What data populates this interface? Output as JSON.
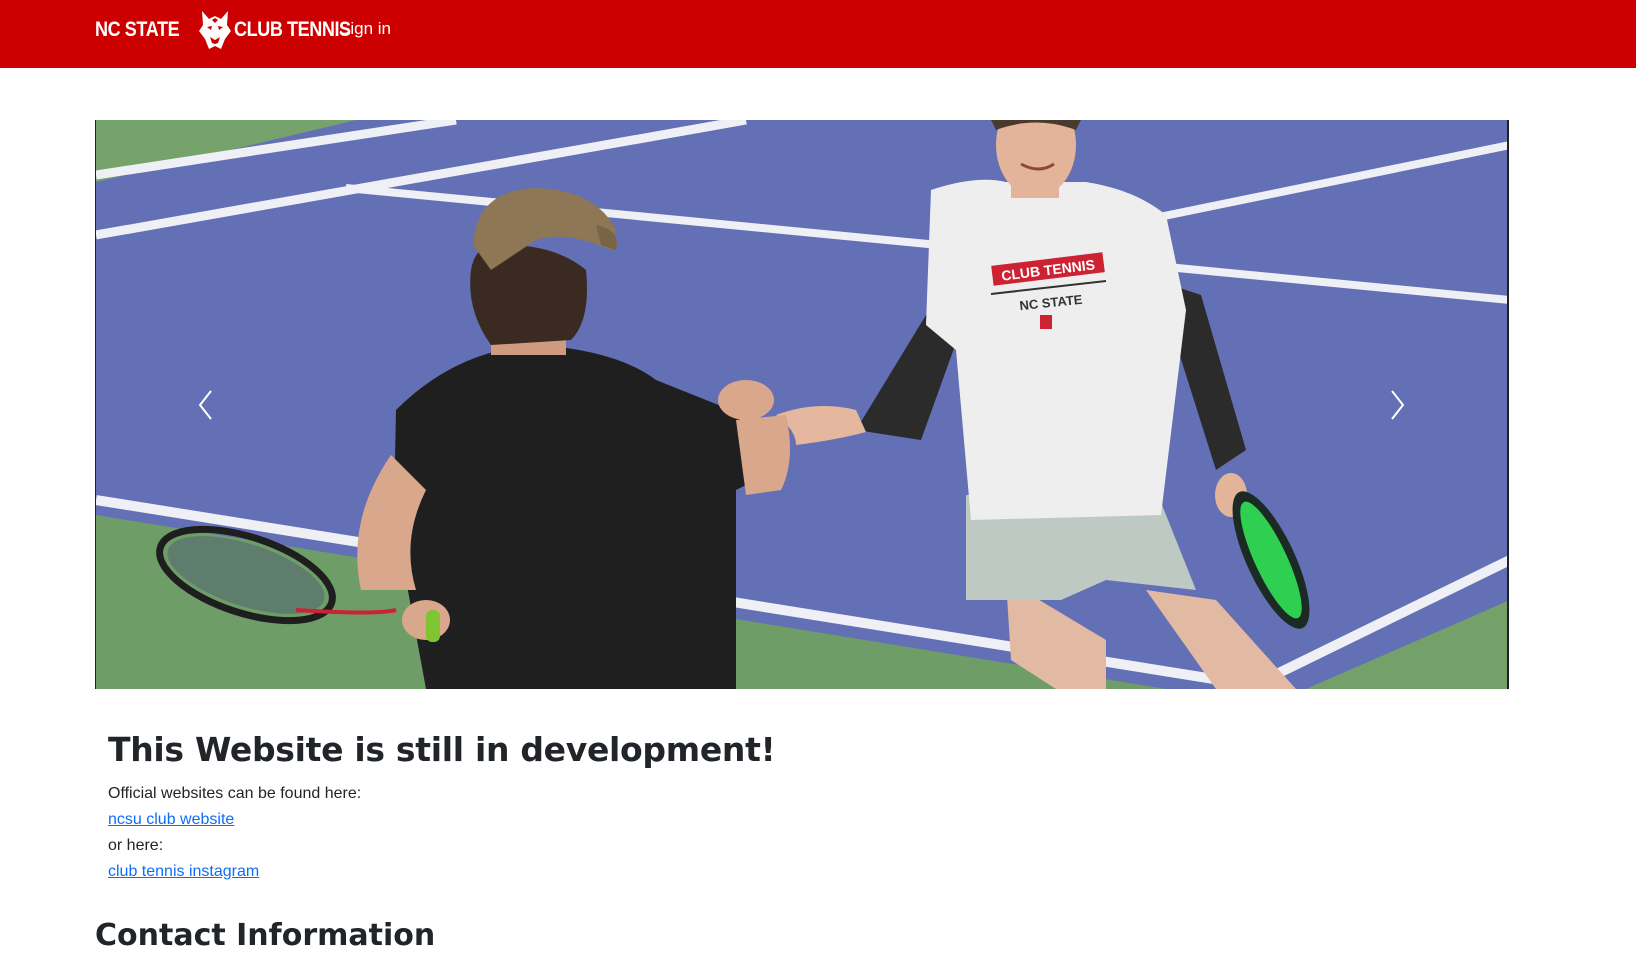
{
  "navbar": {
    "brand_left": "NC STATE",
    "brand_right": "CLUB TENNIS",
    "logo_icon": "wolf-head-icon",
    "signin_label": "Sign in",
    "color": "#cc0000"
  },
  "carousel": {
    "slide_image": "tennis-players-handshake-photo",
    "shirt_line1": "CLUB TENNIS",
    "shirt_line2": "NC STATE",
    "prev_icon": "chevron-left-icon",
    "next_icon": "chevron-right-icon"
  },
  "main": {
    "headline": "This Website is still in development!",
    "intro": "Official websites can be found here:",
    "link1": "ncsu club website",
    "or_text": "or here:",
    "link2": "club tennis instagram",
    "contact_heading": "Contact Information",
    "link_color": "#0d6efd"
  }
}
